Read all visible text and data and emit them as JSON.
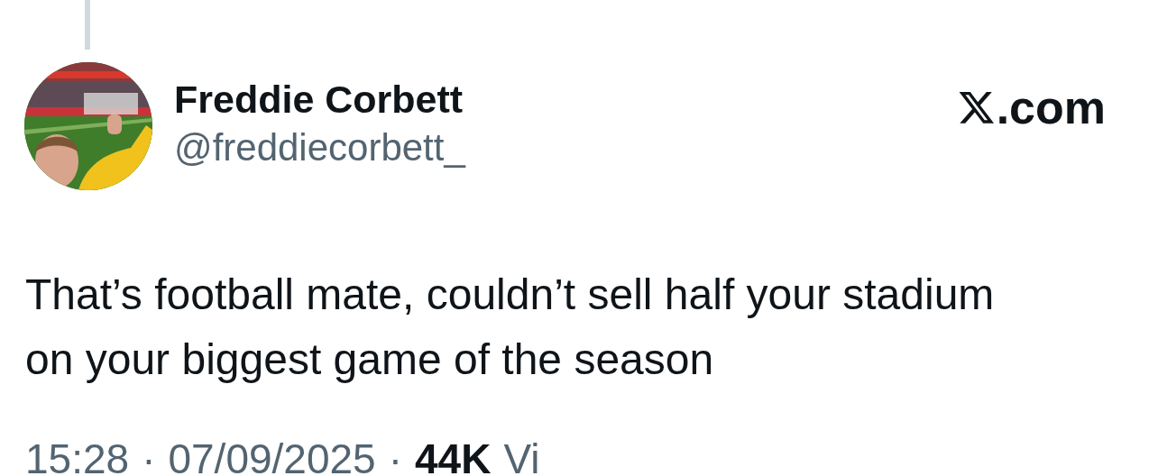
{
  "author": {
    "name": "Freddie Corbett",
    "handle": "@freddiecorbett_"
  },
  "brand": {
    "text": ".com"
  },
  "tweet": {
    "text": "That’s football mate, couldn’t sell half your stadium on your biggest game of the season"
  },
  "meta": {
    "time": "15:28",
    "separator_1": "·",
    "date": "07/09/2025",
    "separator_2": "·",
    "views": "44K",
    "views_label": "Vi"
  }
}
